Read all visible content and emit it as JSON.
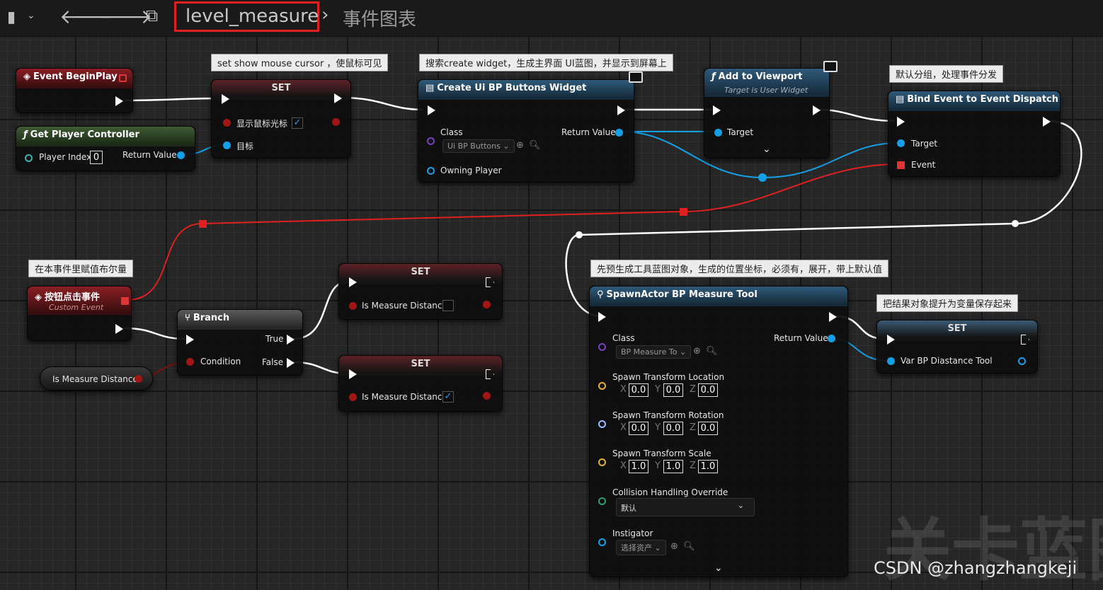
{
  "breadcrumb": {
    "graph_name": "level_measure",
    "graph_type": "事件图表",
    "highlight_color": "#e02020"
  },
  "comments": {
    "c1": "set show mouse cursor ，使鼠标可见",
    "c2": "搜索create widget，生成主界面 UI蓝图，并显示到屏幕上",
    "c3": "默认分组，处理事件分发",
    "c4": "在本事件里赋值布尔量",
    "c5": "先预生成工具蓝图对象，生成的位置坐标，必须有，展开，带上默认值",
    "c6": "把结果对象提升为变量保存起来"
  },
  "nodes": {
    "event_begin_play": {
      "title": "Event BeginPlay"
    },
    "get_player_controller": {
      "title": "Get Player Controller",
      "player_index_label": "Player Index",
      "player_index": "0",
      "return_label": "Return Value"
    },
    "set_cursor": {
      "title": "SET",
      "pin1": "显示鼠标光标",
      "pin2": "目标",
      "checked": "✓"
    },
    "create_widget": {
      "title": "Create Ui BP Buttons Widget",
      "class_label": "Class",
      "class_value": "Ui BP Buttons",
      "return_label": "Return Value",
      "owning_label": "Owning Player"
    },
    "add_viewport": {
      "title": "Add to Viewport",
      "subtitle": "Target is User Widget",
      "target_label": "Target"
    },
    "bind_event": {
      "title": "Bind Event to Event Dispatch",
      "target_label": "Target",
      "event_label": "Event"
    },
    "custom_event": {
      "title": "按钮点击事件",
      "subtitle": "Custom Event"
    },
    "branch": {
      "title": "Branch",
      "true_label": "True",
      "false_label": "False",
      "condition_label": "Condition"
    },
    "get_is_measure": {
      "title": "Is Measure Distance"
    },
    "set_measure_a": {
      "title": "SET",
      "pin": "Is Measure Distance"
    },
    "set_measure_b": {
      "title": "SET",
      "pin": "Is Measure Distance",
      "checked": "✓"
    },
    "spawn_actor": {
      "title": "SpawnActor BP Measure Tool",
      "class_label": "Class",
      "class_value": "BP Measure To",
      "return_label": "Return Value",
      "loc_label": "Spawn Transform Location",
      "loc": [
        "0.0",
        "0.0",
        "0.0"
      ],
      "rot_label": "Spawn Transform Rotation",
      "rot": [
        "0.0",
        "0.0",
        "0.0"
      ],
      "scale_label": "Spawn Transform Scale",
      "scale": [
        "1.0",
        "1.0",
        "1.0"
      ],
      "axes": [
        "X",
        "Y",
        "Z"
      ],
      "collision_label": "Collision Handling Override",
      "collision_value": "默认",
      "instigator_label": "Instigator",
      "instigator_value": "选择资产"
    },
    "set_tool": {
      "title": "SET",
      "pin": "Var BP Diastance Tool"
    }
  },
  "watermark": {
    "text": "关卡蓝图",
    "credit": "CSDN @zhangzhangkeji"
  }
}
